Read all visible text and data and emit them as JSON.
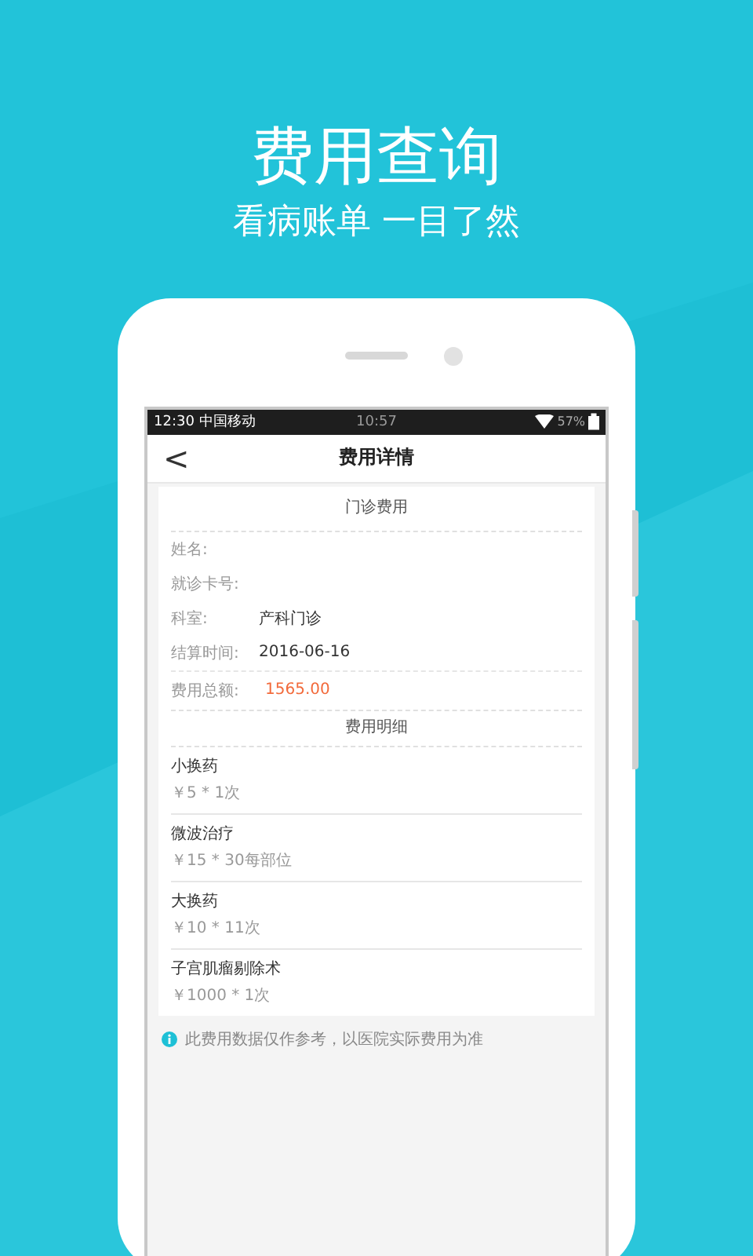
{
  "headline": {
    "title": "费用查询",
    "subtitle": "看病账单 一目了然"
  },
  "status_bar": {
    "left": "12:30 中国移动",
    "time": "10:57",
    "battery": "57%"
  },
  "nav": {
    "back": "<",
    "title": "费用详情"
  },
  "outpatient": {
    "heading": "门诊费用",
    "fields": [
      {
        "label": "姓名:",
        "kind": "plain"
      },
      {
        "label": "就诊卡号:",
        "kind": "plain"
      },
      {
        "label": "科室:",
        "value": "产科门诊",
        "kind": "plain"
      },
      {
        "label": "结算时间:",
        "value": "2016-06-16",
        "kind": "plain"
      },
      {
        "label": "费用总额:",
        "value": "1565.00",
        "kind": "total"
      }
    ]
  },
  "details": {
    "heading": "费用明细",
    "items": [
      {
        "name": "小换药",
        "price": "￥5 * 1次"
      },
      {
        "name": "微波治疗",
        "price": "￥15 * 30每部位"
      },
      {
        "name": "大换药",
        "price": "￥10 * 11次"
      },
      {
        "name": "子宫肌瘤剔除术",
        "price": "￥1000 * 1次"
      }
    ]
  },
  "note": "此费用数据仅作参考，以医院实际费用为准"
}
